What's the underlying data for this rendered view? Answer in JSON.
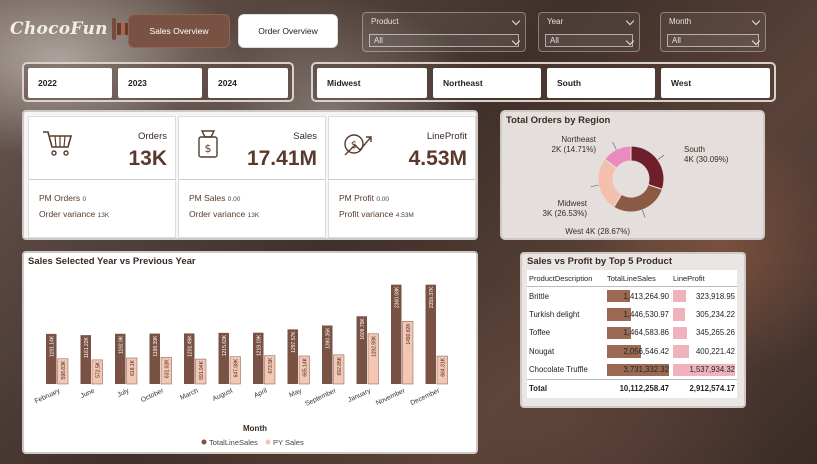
{
  "app": {
    "logo_text": "ChocoFun"
  },
  "nav": {
    "sales_overview": "Sales Overview",
    "order_overview": "Order Overview"
  },
  "filters": {
    "product": {
      "label": "Product",
      "value": "All"
    },
    "year": {
      "label": "Year",
      "value": "All"
    },
    "month": {
      "label": "Month",
      "value": "All"
    }
  },
  "year_tiles": [
    "2022",
    "2023",
    "2024"
  ],
  "region_tiles": [
    "Midwest",
    "Northeast",
    "South",
    "West"
  ],
  "kpis": {
    "orders": {
      "title": "Orders",
      "value": "13K",
      "l1": "PM Orders",
      "v1": "0",
      "l2": "Order variance",
      "v2": "13K"
    },
    "sales": {
      "title": "Sales",
      "value": "17.41M",
      "l1": "PM Sales",
      "v1": "0.00",
      "l2": "Order variance",
      "v2": "13K"
    },
    "profit": {
      "title": "LineProfit",
      "value": "4.53M",
      "l1": "PM Profit",
      "v1": "0.00",
      "l2": "Profit variance",
      "v2": "4.53M"
    }
  },
  "colors": {
    "accent": "#7a5244",
    "sales": "#7a5244",
    "py": "#f4c6b4"
  },
  "chart_data": [
    {
      "type": "pie",
      "title": "Total Orders by Region",
      "slices": [
        {
          "name": "South",
          "label": "4K (30.09%)",
          "value": 30.09,
          "color": "#6e1f2b"
        },
        {
          "name": "West",
          "label": "West 4K (28.67%)",
          "value": 28.67,
          "color": "#8a5a44"
        },
        {
          "name": "Midwest",
          "label": "3K (26.53%)",
          "value": 26.53,
          "color": "#f3c0ae"
        },
        {
          "name": "Northeast",
          "label": "2K (14.71%)",
          "value": 14.71,
          "color": "#e98bbf"
        }
      ]
    },
    {
      "type": "bar",
      "title": "Sales Selected Year vs Previous Year",
      "xlabel": "Month",
      "categories": [
        "February",
        "June",
        "July",
        "October",
        "March",
        "August",
        "April",
        "May",
        "September",
        "January",
        "November",
        "December"
      ],
      "series": [
        {
          "name": "TotalLineSales",
          "values": [
            1191.14,
            1161.22,
            1192.9,
            1198.39,
            1201.49,
            1215.63,
            1219.19,
            1297.57,
            1390.35,
            1609.75,
            2360.08,
            2359.37
          ],
          "labels": [
            "1191.14K",
            "1161.22K",
            "1192.9K",
            "1198.39K",
            "1201.49K",
            "1215.63K",
            "1219.19K",
            "1297.57K",
            "1390.35K",
            "1609.75K",
            "2360.08K",
            "2359.37K"
          ],
          "color": "#7a5244"
        },
        {
          "name": "PY Sales",
          "values": [
            598.83,
            572.5,
            618.1,
            631.03,
            591.94,
            647.08,
            673.5,
            665.14,
            692.85,
            1192.99,
            1490.82,
            664.31
          ],
          "labels": [
            "598.83K",
            "572.5K",
            "618.1K",
            "631.03K",
            "591.94K",
            "647.08K",
            "673.5K",
            "665.14K",
            "692.85K",
            "1192.99K",
            "1490.82K",
            "664.31K"
          ],
          "color": "#f4c6b4"
        }
      ],
      "legend": "bottom"
    },
    {
      "type": "table",
      "title": "Sales vs Profit by Top 5 Product",
      "columns": [
        "ProductDescription",
        "TotalLineSales",
        "LineProfit"
      ],
      "rows": [
        {
          "name": "Brittle",
          "sales": "1,413,264.90",
          "profit": "323,918.95",
          "sales_v": 1413264.9,
          "profit_v": 323918.95
        },
        {
          "name": "Turkish delight",
          "sales": "1,446,530.97",
          "profit": "305,234.22",
          "sales_v": 1446530.97,
          "profit_v": 305234.22
        },
        {
          "name": "Toffee",
          "sales": "1,464,583.86",
          "profit": "345,265.26",
          "sales_v": 1464583.86,
          "profit_v": 345265.26
        },
        {
          "name": "Nougat",
          "sales": "2,056,546.42",
          "profit": "400,221.42",
          "sales_v": 2056546.42,
          "profit_v": 400221.42
        },
        {
          "name": "Chocolate Truffle",
          "sales": "3,731,332.32",
          "profit": "1,537,934.32",
          "sales_v": 3731332.32,
          "profit_v": 1537934.32
        }
      ],
      "total": {
        "name": "Total",
        "sales": "10,112,258.47",
        "profit": "2,912,574.17"
      }
    }
  ]
}
